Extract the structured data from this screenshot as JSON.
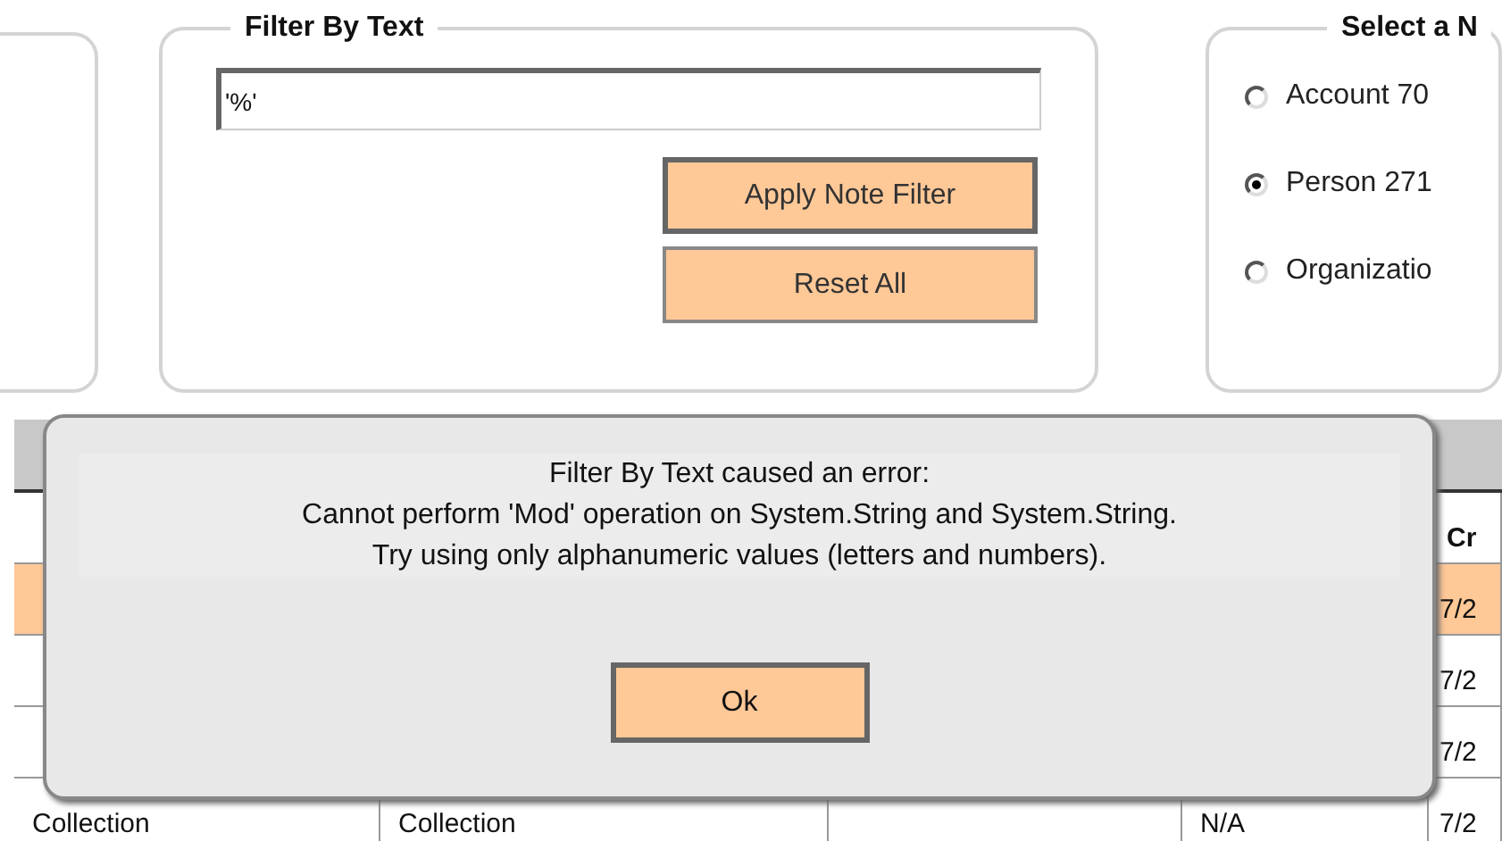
{
  "filter_panel": {
    "title": "Filter By Text",
    "value": "'%'",
    "buttons": [
      {
        "label": "Apply Note Filter",
        "focused": true
      },
      {
        "label": "Reset All",
        "focused": false
      }
    ]
  },
  "select_panel": {
    "title": "Select a N",
    "options": [
      {
        "label": "Account 70",
        "selected": false
      },
      {
        "label": "Person 271",
        "selected": true
      },
      {
        "label": "Organizatio",
        "selected": false
      }
    ]
  },
  "table": {
    "header": {
      "column_5": "Cr"
    },
    "rows": [
      {
        "selected": true,
        "cells": {
          "column_5": "7/2"
        }
      },
      {
        "selected": false,
        "cells": {
          "column_5": "7/2"
        }
      },
      {
        "selected": false,
        "cells": {
          "column_5": "7/2"
        }
      },
      {
        "selected": false,
        "cells": {
          "column_1": "Collection",
          "column_2": "Collection",
          "column_4": "N/A",
          "column_5": "7/2"
        }
      }
    ]
  },
  "dialog": {
    "lines": [
      "Filter By Text caused an error:",
      "Cannot perform 'Mod' operation on System.String and System.String.",
      "Try using only alphanumeric values (letters and numbers)."
    ],
    "button": "Ok"
  }
}
